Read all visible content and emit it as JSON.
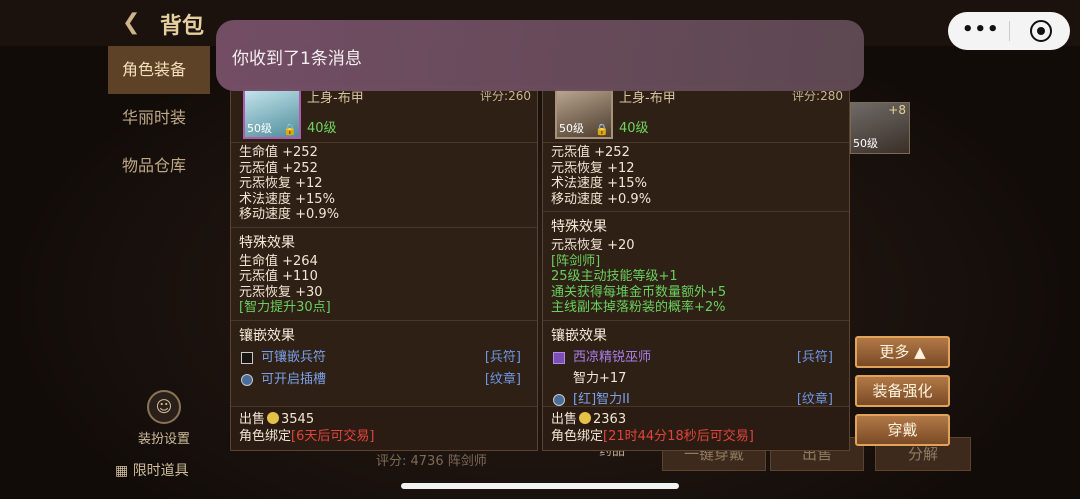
{
  "header": {
    "title": "背包",
    "back_icon": "back-arrow-icon"
  },
  "notification": {
    "text": "你收到了1条消息"
  },
  "capsule": {
    "more_label": "•••",
    "icons": [
      "more-icon",
      "close-target-icon"
    ]
  },
  "left_tabs": [
    {
      "label": "角色装备",
      "active": true
    },
    {
      "label": "华丽时装",
      "active": false
    },
    {
      "label": "物品仓库",
      "active": false
    }
  ],
  "bottom_left": {
    "outfit_label": "装扮设置",
    "limited_label": "限时道具"
  },
  "underlying": {
    "score_text": "评分: 4736   阵剑师",
    "potion_label": "药品",
    "buttons": [
      "一键穿戴",
      "出售",
      "分解"
    ]
  },
  "left_panel": {
    "name": "上身-布甲",
    "score": "评分:260",
    "item_level": "50级",
    "req_level": "40级",
    "stats": [
      "生命值 +252",
      "元炁值 +252",
      "元炁恢复 +12",
      "术法速度 +15%",
      "移动速度 +0.9%"
    ],
    "special_title": "特殊效果",
    "special": [
      "生命值 +264",
      "元炁值 +110",
      "元炁恢复 +30"
    ],
    "special_green": [
      "[智力提升30点]"
    ],
    "gem_title": "镶嵌效果",
    "gems": [
      {
        "name": "可镶嵌兵符",
        "type": "[兵符]"
      },
      {
        "name": "可开启插槽",
        "type": "[纹章]"
      }
    ],
    "sell_label": "出售",
    "sell_price": "3545",
    "bind_label": "角色绑定",
    "bind_note": "[6天后可交易]"
  },
  "right_panel": {
    "name": "上身-布甲",
    "score": "评分:280",
    "item_level": "50级",
    "req_level": "40级",
    "stats": [
      "元炁值 +252",
      "元炁恢复 +12",
      "术法速度 +15%",
      "移动速度 +0.9%"
    ],
    "special_title": "特殊效果",
    "special": [
      "元炁恢复 +20"
    ],
    "special_green": [
      "[阵剑师]",
      "25级主动技能等级+1",
      "通关获得每堆金币数量额外+5",
      "主线副本掉落粉装的概率+2%"
    ],
    "gem_title": "镶嵌效果",
    "gems": [
      {
        "name": "西凉精锐巫师",
        "type": "[兵符]",
        "sub": "智力+17"
      },
      {
        "name": "[红]智力II",
        "type": "[纹章]"
      }
    ],
    "sell_label": "出售",
    "sell_price": "2363",
    "bind_label": "角色绑定",
    "bind_note": "[21时44分18秒后可交易]"
  },
  "actions": {
    "more": "更多",
    "enhance": "装备强化",
    "equip": "穿戴"
  },
  "side_item": {
    "level": "50级",
    "plus": "+8"
  }
}
